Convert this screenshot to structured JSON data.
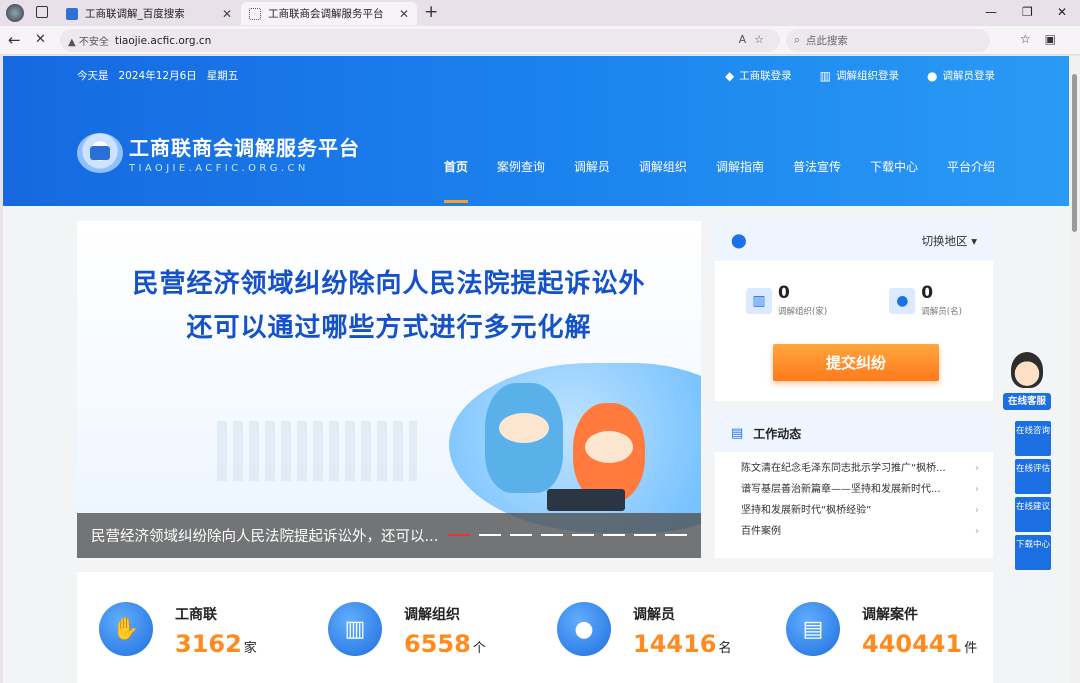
{
  "browser": {
    "tabs": [
      {
        "title": "工商联调解_百度搜索",
        "active": false
      },
      {
        "title": "工商联商会调解服务平台",
        "active": true
      }
    ],
    "security_label": "不安全",
    "url": "tiaojie.acfic.org.cn",
    "search_placeholder": "点此搜索",
    "controls": {
      "minimize": "—",
      "maximize": "❐",
      "close": "✕",
      "new_tab": "+",
      "back": "←",
      "reload": "✕",
      "tab_close": "✕"
    }
  },
  "header": {
    "date_prefix": "今天是",
    "date": "2024年12月6日",
    "weekday": "星期五",
    "logins": [
      {
        "label": "工商联登录",
        "icon": "diamond-icon"
      },
      {
        "label": "调解组织登录",
        "icon": "building-icon"
      },
      {
        "label": "调解员登录",
        "icon": "user-icon"
      }
    ],
    "logo_title": "工商联商会调解服务平台",
    "logo_subtitle": "TIAOJIE.ACFIC.ORG.CN",
    "nav": [
      "首页",
      "案例查询",
      "调解员",
      "调解组织",
      "调解指南",
      "普法宣传",
      "下载中心",
      "平台介绍"
    ],
    "active_nav": "首页"
  },
  "banner": {
    "headline_1": "民营经济领域纠纷除向人民法院提起诉讼外",
    "headline_2": "还可以通过哪些方式进行多元化解",
    "caption": "民营经济领域纠纷除向人民法院提起诉讼外，还可以...",
    "slide_count": 8,
    "active_slide": 1
  },
  "region_card": {
    "switch_label": "切换地区",
    "dropdown_glyph": "▾",
    "stats": [
      {
        "value": "0",
        "label": "调解组织(家)",
        "icon": "building-icon"
      },
      {
        "value": "0",
        "label": "调解员(名)",
        "icon": "user-icon"
      }
    ],
    "submit_label": "提交纠纷"
  },
  "news": {
    "title": "工作动态",
    "items": [
      "陈文清在纪念毛泽东同志批示学习推广“枫桥...",
      "谱写基层善治新篇章——坚持和发展新时代...",
      "坚持和发展新时代“枫桥经验”",
      "百件案例"
    ]
  },
  "side": {
    "kefu_label": "在线客服",
    "buttons": [
      "在线咨询",
      "在线评估",
      "在线建议",
      "下载中心"
    ]
  },
  "stats_row": [
    {
      "title": "工商联",
      "value": "3162",
      "unit": "家",
      "icon": "handshake-icon"
    },
    {
      "title": "调解组织",
      "value": "6558",
      "unit": "个",
      "icon": "building-icon"
    },
    {
      "title": "调解员",
      "value": "14416",
      "unit": "名",
      "icon": "people-icon"
    },
    {
      "title": "调解案件",
      "value": "440441",
      "unit": "件",
      "icon": "document-icon"
    }
  ],
  "colors": {
    "primary": "#1b72e8",
    "accent": "#ff8a1f",
    "active_dot": "#e23a2e"
  }
}
